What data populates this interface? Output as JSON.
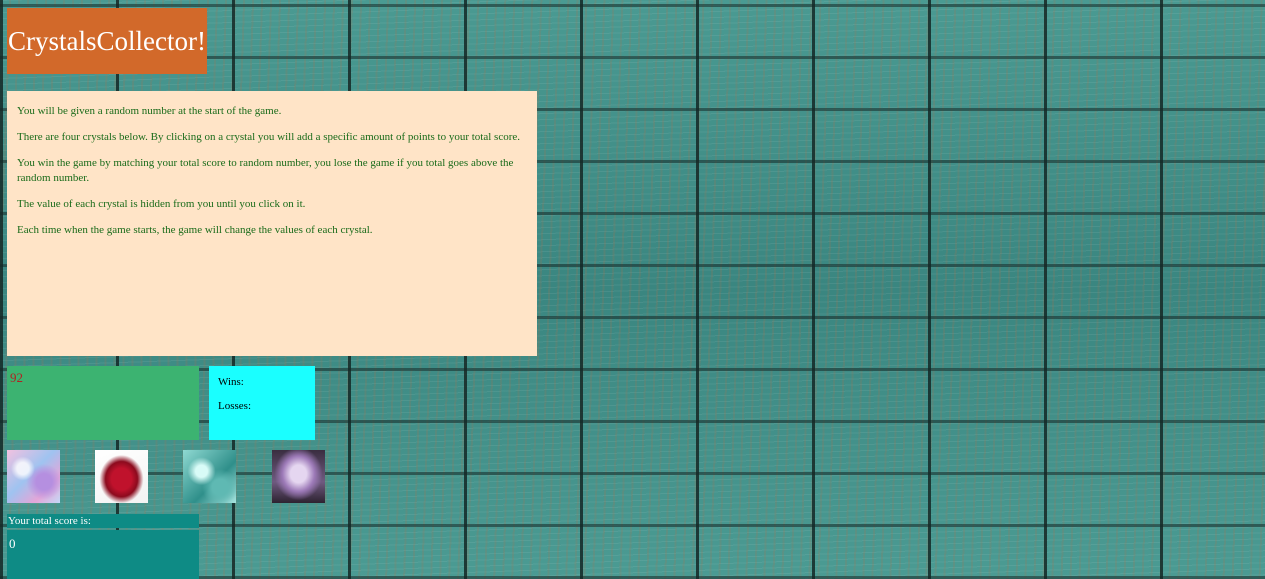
{
  "header": {
    "title": "CrystalsCollector!"
  },
  "instructions": [
    "You will be given a random number at the start of the game.",
    "There are four crystals below. By clicking on a crystal you will add a specific amount of points to your total score.",
    "You win the game by matching your total score to random number, you lose the game if you total goes above the random number.",
    "The value of each crystal is hidden from you until you click on it.",
    "Each time when the game starts, the game will change the values of each crystal."
  ],
  "game": {
    "random_number": "92",
    "wins_label": "Wins:",
    "losses_label": "Losses:",
    "score_label": "Your total score is:",
    "score_value": "0"
  },
  "crystals": [
    {
      "name": "pink-blue-crystal",
      "color": "#e3a6d8"
    },
    {
      "name": "red-crystal",
      "color": "#c0122c"
    },
    {
      "name": "teal-crystal",
      "color": "#5fb9b3"
    },
    {
      "name": "purple-amethyst-crystal",
      "color": "#9d7ab8"
    }
  ],
  "colors": {
    "title_bg": "#d2692a",
    "instructions_bg": "#ffe4c7",
    "instructions_text": "#1a6b1a",
    "target_bg": "#3cb371",
    "target_text": "#b22222",
    "stats_bg": "#1affff",
    "score_bg": "#0e8b85"
  }
}
